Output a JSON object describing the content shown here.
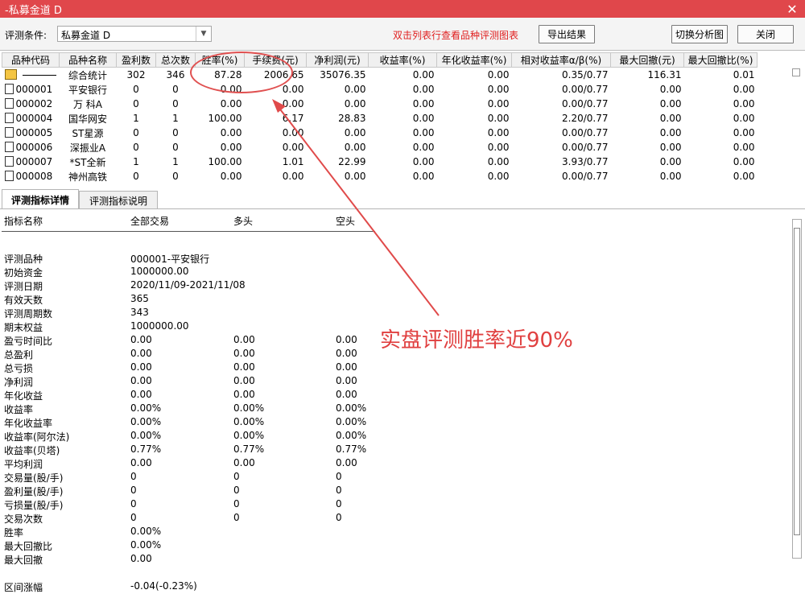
{
  "window": {
    "title": "-私募金道 D",
    "close_glyph": "✕"
  },
  "toolbar": {
    "condition_label": "评测条件:",
    "condition_value": "私募金道 D",
    "hint": "双击列表行查看品种评测图表",
    "export_label": "导出结果",
    "switch_label": "切换分析图",
    "close_label": "关闭"
  },
  "grid": {
    "columns": [
      "品种代码",
      "品种名称",
      "盈利数",
      "总次数",
      "胜率(%)",
      "手续费(元)",
      "净利润(元)",
      "收益率(%)",
      "年化收益率(%)",
      "相对收益率α/β(%)",
      "最大回撤(元)",
      "最大回撤比(%)"
    ],
    "rows": [
      {
        "code": "",
        "name": "综合统计",
        "win": "302",
        "total": "346",
        "rate": "87.28",
        "fee": "2006.65",
        "profit": "35076.35",
        "ret": "0.00",
        "annual": "0.00",
        "rel": "0.35/0.77",
        "dd": "116.31",
        "ddr": "0.01"
      },
      {
        "code": "000001",
        "name": "平安银行",
        "win": "0",
        "total": "0",
        "rate": "0.00",
        "fee": "0.00",
        "profit": "0.00",
        "ret": "0.00",
        "annual": "0.00",
        "rel": "0.00/0.77",
        "dd": "0.00",
        "ddr": "0.00"
      },
      {
        "code": "000002",
        "name": "万 科A",
        "win": "0",
        "total": "0",
        "rate": "0.00",
        "fee": "0.00",
        "profit": "0.00",
        "ret": "0.00",
        "annual": "0.00",
        "rel": "0.00/0.77",
        "dd": "0.00",
        "ddr": "0.00"
      },
      {
        "code": "000004",
        "name": "国华网安",
        "win": "1",
        "total": "1",
        "rate": "100.00",
        "fee": "6.17",
        "profit": "28.83",
        "ret": "0.00",
        "annual": "0.00",
        "rel": "2.20/0.77",
        "dd": "0.00",
        "ddr": "0.00"
      },
      {
        "code": "000005",
        "name": "ST星源",
        "win": "0",
        "total": "0",
        "rate": "0.00",
        "fee": "0.00",
        "profit": "0.00",
        "ret": "0.00",
        "annual": "0.00",
        "rel": "0.00/0.77",
        "dd": "0.00",
        "ddr": "0.00"
      },
      {
        "code": "000006",
        "name": "深振业A",
        "win": "0",
        "total": "0",
        "rate": "0.00",
        "fee": "0.00",
        "profit": "0.00",
        "ret": "0.00",
        "annual": "0.00",
        "rel": "0.00/0.77",
        "dd": "0.00",
        "ddr": "0.00"
      },
      {
        "code": "000007",
        "name": "*ST全新",
        "win": "1",
        "total": "1",
        "rate": "100.00",
        "fee": "1.01",
        "profit": "22.99",
        "ret": "0.00",
        "annual": "0.00",
        "rel": "3.93/0.77",
        "dd": "0.00",
        "ddr": "0.00"
      },
      {
        "code": "000008",
        "name": "神州高铁",
        "win": "0",
        "total": "0",
        "rate": "0.00",
        "fee": "0.00",
        "profit": "0.00",
        "ret": "0.00",
        "annual": "0.00",
        "rel": "0.00/0.77",
        "dd": "0.00",
        "ddr": "0.00"
      }
    ]
  },
  "tabs": {
    "details": "评测指标详情",
    "description": "评测指标说明"
  },
  "detail": {
    "headers": [
      "指标名称",
      "全部交易",
      "多头",
      "空头"
    ],
    "rows": [
      [
        "",
        "",
        "",
        ""
      ],
      [
        "评测品种",
        "000001-平安银行",
        "",
        ""
      ],
      [
        "初始资金",
        "1000000.00",
        "",
        ""
      ],
      [
        "评测日期",
        "2020/11/09-2021/11/08",
        "",
        ""
      ],
      [
        "有效天数",
        "365",
        "",
        ""
      ],
      [
        "评测周期数",
        "343",
        "",
        ""
      ],
      [
        "期末权益",
        "1000000.00",
        "",
        ""
      ],
      [
        "盈亏时间比",
        "0.00",
        "0.00",
        "0.00"
      ],
      [
        "总盈利",
        "0.00",
        "0.00",
        "0.00"
      ],
      [
        "总亏损",
        "0.00",
        "0.00",
        "0.00"
      ],
      [
        "净利润",
        "0.00",
        "0.00",
        "0.00"
      ],
      [
        "年化收益",
        "0.00",
        "0.00",
        "0.00"
      ],
      [
        "收益率",
        "0.00%",
        "0.00%",
        "0.00%"
      ],
      [
        "年化收益率",
        "0.00%",
        "0.00%",
        "0.00%"
      ],
      [
        "收益率(阿尔法)",
        "0.00%",
        "0.00%",
        "0.00%"
      ],
      [
        "收益率(贝塔)",
        "0.77%",
        "0.77%",
        "0.77%"
      ],
      [
        "平均利润",
        "0.00",
        "0.00",
        "0.00"
      ],
      [
        "交易量(股/手)",
        "0",
        "0",
        "0"
      ],
      [
        "盈利量(股/手)",
        "0",
        "0",
        "0"
      ],
      [
        "亏损量(股/手)",
        "0",
        "0",
        "0"
      ],
      [
        "交易次数",
        "0",
        "0",
        "0"
      ],
      [
        "胜率",
        "0.00%",
        "",
        ""
      ],
      [
        "最大回撤比",
        "0.00%",
        "",
        ""
      ],
      [
        "最大回撤",
        "0.00",
        "",
        ""
      ],
      [
        "",
        "",
        "",
        ""
      ],
      [
        "区间涨幅",
        "-0.04(-0.23%)",
        "",
        ""
      ]
    ]
  },
  "annotation": {
    "text": "实盘评测胜率近90%",
    "color": "#e04040"
  }
}
